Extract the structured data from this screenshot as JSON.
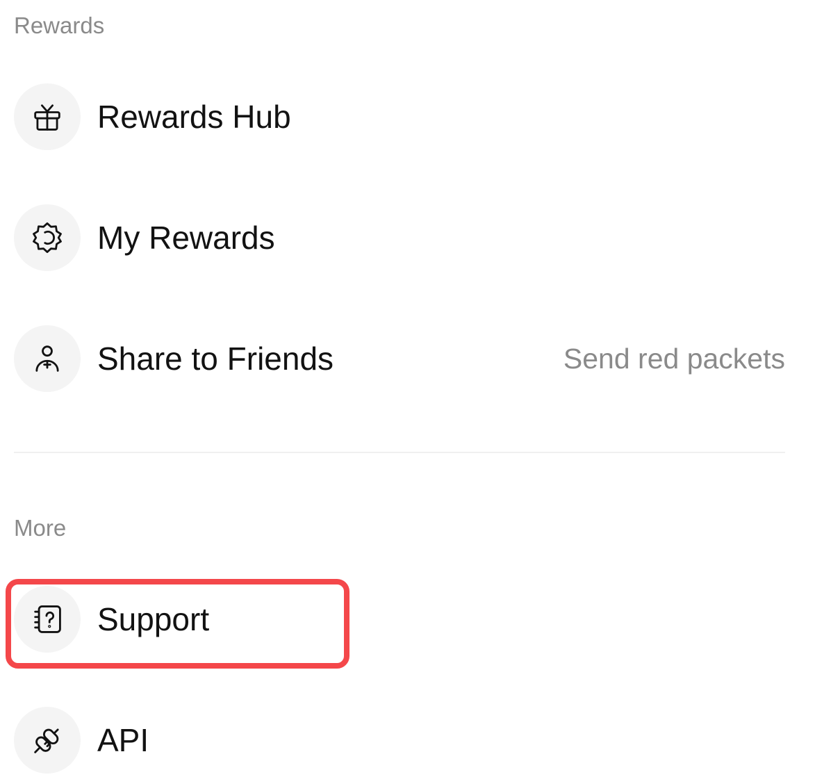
{
  "sections": {
    "rewards": {
      "title": "Rewards",
      "items": [
        {
          "label": "Rewards Hub",
          "icon": "gift-icon"
        },
        {
          "label": "My Rewards",
          "icon": "badge-icon"
        },
        {
          "label": "Share to Friends",
          "icon": "add-friend-icon",
          "hint": "Send red packets"
        }
      ]
    },
    "more": {
      "title": "More",
      "items": [
        {
          "label": "Support",
          "icon": "help-book-icon",
          "highlighted": true
        },
        {
          "label": "API",
          "icon": "plug-icon"
        }
      ]
    }
  },
  "colors": {
    "highlight": "#f4474a",
    "muted_text": "#8a8a8a",
    "icon_bg": "#f4f4f4"
  }
}
